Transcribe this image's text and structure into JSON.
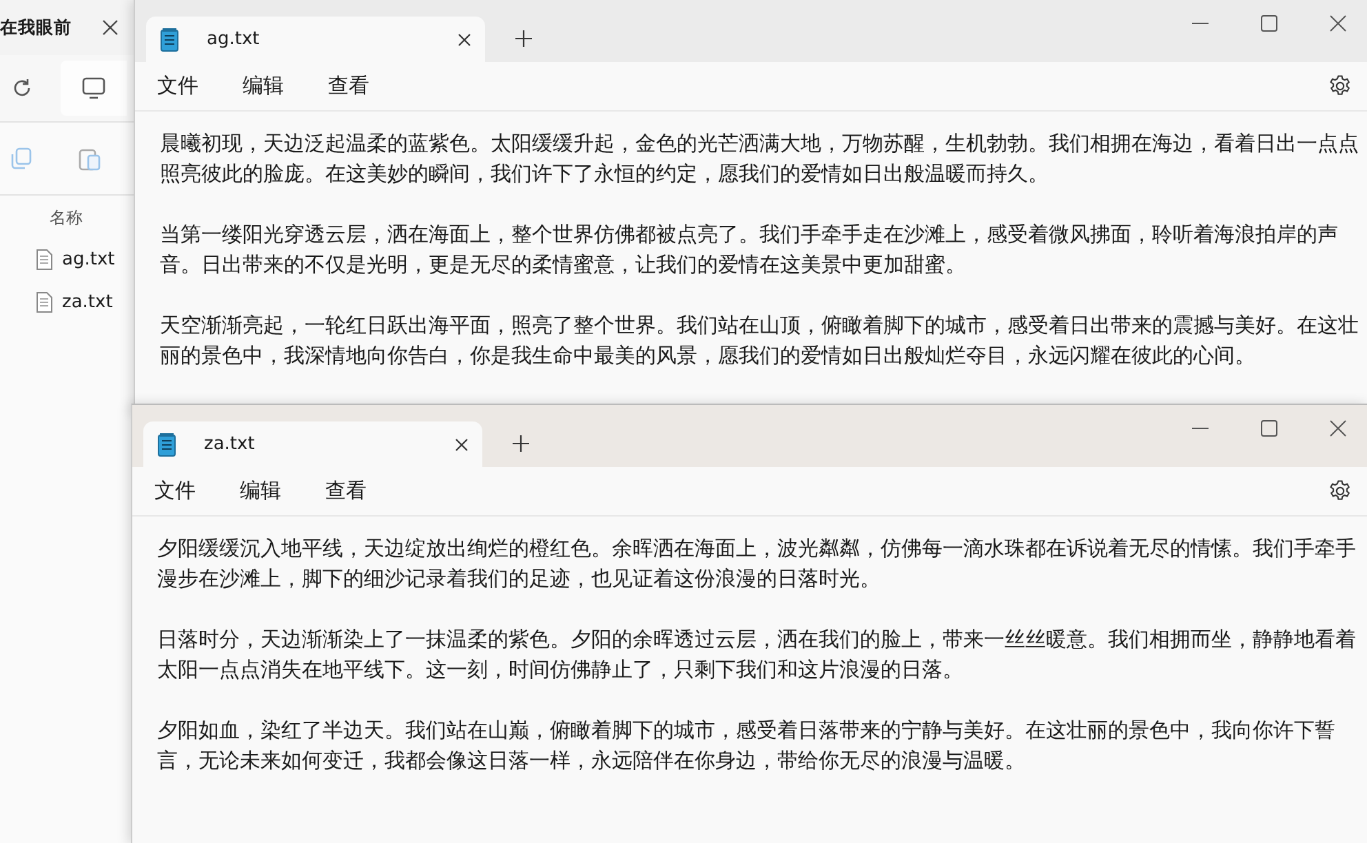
{
  "explorer": {
    "title": "在我眼前",
    "column_header": "名称",
    "files": [
      "ag.txt",
      "za.txt"
    ]
  },
  "notepads": [
    {
      "tab_title": "ag.txt",
      "menu": [
        "文件",
        "编辑",
        "查看"
      ],
      "paragraphs": [
        "晨曦初现，天边泛起温柔的蓝紫色。太阳缓缓升起，金色的光芒洒满大地，万物苏醒，生机勃勃。我们相拥在海边，看着日出一点点照亮彼此的脸庞。在这美妙的瞬间，我们许下了永恒的约定，愿我们的爱情如日出般温暖而持久。",
        "当第一缕阳光穿透云层，洒在海面上，整个世界仿佛都被点亮了。我们手牵手走在沙滩上，感受着微风拂面，聆听着海浪拍岸的声音。日出带来的不仅是光明，更是无尽的柔情蜜意，让我们的爱情在这美景中更加甜蜜。",
        "天空渐渐亮起，一轮红日跃出海平面，照亮了整个世界。我们站在山顶，俯瞰着脚下的城市，感受着日出带来的震撼与美好。在这壮丽的景色中，我深情地向你告白，你是我生命中最美的风景，愿我们的爱情如日出般灿烂夺目，永远闪耀在彼此的心间。"
      ]
    },
    {
      "tab_title": "za.txt",
      "menu": [
        "文件",
        "编辑",
        "查看"
      ],
      "paragraphs": [
        "夕阳缓缓沉入地平线，天边绽放出绚烂的橙红色。余晖洒在海面上，波光粼粼，仿佛每一滴水珠都在诉说着无尽的情愫。我们手牵手漫步在沙滩上，脚下的细沙记录着我们的足迹，也见证着这份浪漫的日落时光。",
        "日落时分，天边渐渐染上了一抹温柔的紫色。夕阳的余晖透过云层，洒在我们的脸上，带来一丝丝暖意。我们相拥而坐，静静地看着太阳一点点消失在地平线下。这一刻，时间仿佛静止了，只剩下我们和这片浪漫的日落。",
        "夕阳如血，染红了半边天。我们站在山巅，俯瞰着脚下的城市，感受着日落带来的宁静与美好。在这壮丽的景色中，我向你许下誓言，无论未来如何变迁，我都会像这日落一样，永远陪伴在你身边，带给你无尽的浪漫与温暖。"
      ]
    }
  ]
}
